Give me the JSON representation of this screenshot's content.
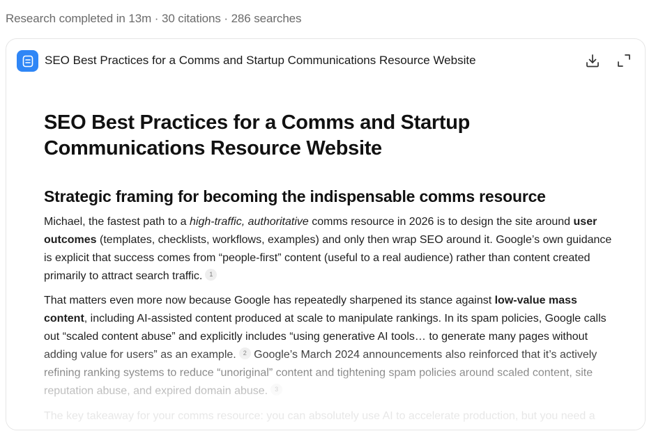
{
  "summary": {
    "text": "Research completed in 13m · 30 citations · 286 searches"
  },
  "header": {
    "title": "SEO Best Practices for a Comms and Startup Communications Resource Website",
    "icons": {
      "doc": "document-icon",
      "download": "download-icon",
      "expand": "expand-icon"
    }
  },
  "doc": {
    "h1": "SEO Best Practices for a Comms and Startup Communications Resource Website",
    "h2": "Strategic framing for becoming the indispensable comms resource",
    "p1": {
      "a": "Michael, the fastest path to a ",
      "b_em": "high-traffic, authoritative",
      "c": " comms resource in 2026 is to design the site around ",
      "d_strong": "user outcomes",
      "e": " (templates, checklists, workflows, examples) and only then wrap SEO around it. Google’s own guidance is explicit that success comes from “people-first” content (useful to a real audience) rather than content created primarily to attract search traffic.",
      "cite": "1"
    },
    "p2": {
      "a": "That matters even more now because Google has repeatedly sharpened its stance against ",
      "b_strong": "low-value mass content",
      "c": ", including AI-assisted content produced at scale to manipulate rankings. In its spam policies, Google calls out “scaled content abuse” and explicitly includes “using generative AI tools… to generate many pages without adding value for users” as an example.",
      "cite1": "2",
      "d": " Google’s March 2024 announcements also reinforced that it’s actively refining ranking systems to reduce “unoriginal” content and tightening spam policies around scaled content, site reputation abuse, and expired domain abuse.",
      "cite2": "3"
    },
    "p3": {
      "a": "The key takeaway for your comms resource: you can absolutely use AI to accelerate production, but you need a"
    }
  },
  "colors": {
    "accent": "#2f86f6",
    "meta_text": "#6b6b6b",
    "border": "#e6e6e6"
  }
}
